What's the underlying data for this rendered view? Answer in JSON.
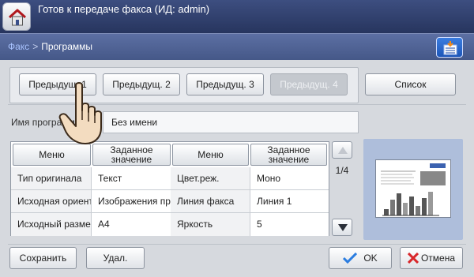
{
  "header": {
    "title": "Готов к передаче факса (ИД: admin)"
  },
  "breadcrumb": {
    "parent": "Факс",
    "separator": ">",
    "current": "Программы"
  },
  "programs": {
    "buttons": [
      {
        "label": "Предыдущ. 1",
        "enabled": true
      },
      {
        "label": "Предыдущ. 2",
        "enabled": true
      },
      {
        "label": "Предыдущ. 3",
        "enabled": true
      },
      {
        "label": "Предыдущ. 4",
        "enabled": false
      }
    ],
    "list_label": "Список"
  },
  "program_name": {
    "label": "Имя программы",
    "value": "Без имени"
  },
  "table": {
    "headers": [
      "Меню",
      "Заданное значение",
      "Меню",
      "Заданное значение"
    ],
    "rows": [
      {
        "menu1": "Тип оригинала",
        "value1": "Текст",
        "menu2": "Цвет.реж.",
        "value2": "Моно"
      },
      {
        "menu1": "Исходная ориентация",
        "value1": "Изображения прямо",
        "menu2": "Линия факса",
        "value2": "Линия 1"
      },
      {
        "menu1": "Исходный размер",
        "value1": "A4",
        "menu2": "Яркость",
        "value2": "5"
      }
    ],
    "page_indicator": "1/4"
  },
  "footer": {
    "save_label": "Сохранить",
    "delete_label": "Удал.",
    "ok_label": "OK",
    "cancel_label": "Отмена"
  },
  "colors": {
    "top_bar": "#27355e",
    "nav_bar": "#455888",
    "accent_blue": "#1d56b8",
    "ok_check": "#2b7de0",
    "cancel_x": "#d8262a"
  }
}
